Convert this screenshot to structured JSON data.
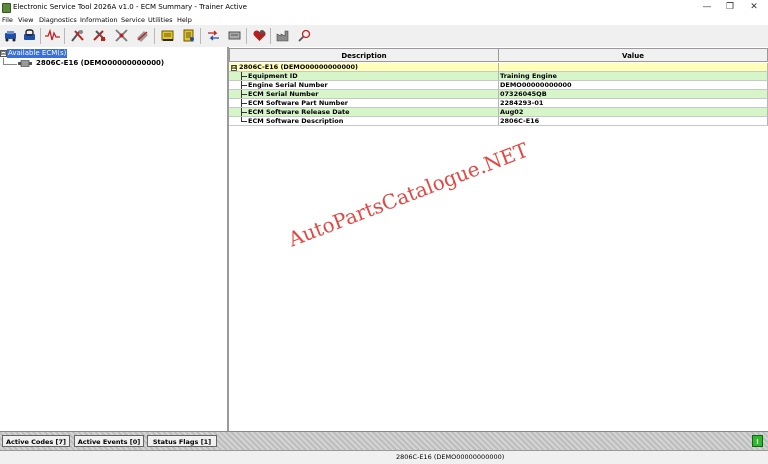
{
  "window": {
    "title": "Electronic Service Tool 2026A v1.0 - ECM Summary - Trainer Active",
    "controls": [
      "—",
      "❐",
      "✕"
    ]
  },
  "menu": [
    "File",
    "View",
    "Diagnostics",
    "Information",
    "Service",
    "Utilities",
    "Help"
  ],
  "toolbar": {
    "icons": [
      "connect-icon",
      "disconnect-icon",
      "waveform-icon",
      "diag-tools-1-icon",
      "diag-tools-2-icon",
      "diag-tools-3-icon",
      "diag-tools-4-icon",
      "info-book-icon",
      "info-list-icon",
      "transfer-icon",
      "config-icon",
      "heart-icon",
      "factory-icon",
      "search-icon"
    ]
  },
  "tree": {
    "root_label": "Available ECM(s)",
    "root_toggle": "⊟",
    "child_label": "2806C-E16 (DEMO00000000000)"
  },
  "grid": {
    "headers": [
      "Description",
      "Value"
    ],
    "group_label": "2806C-E16 (DEMO00000000000)",
    "group_toggle": "⊟",
    "rows": [
      {
        "description": "Equipment ID",
        "value": "Training Engine"
      },
      {
        "description": "Engine Serial Number",
        "value": "DEMO00000000000"
      },
      {
        "description": "ECM Serial Number",
        "value": "07326045QB"
      },
      {
        "description": "ECM Software Part Number",
        "value": "2284293-01"
      },
      {
        "description": "ECM Software Release Date",
        "value": "Aug02"
      },
      {
        "description": "ECM Software Description",
        "value": "2806C-E16"
      }
    ]
  },
  "watermark": "AutoPartsCatalogue.NET",
  "bottom_tabs": [
    {
      "label": "Active Codes [7]"
    },
    {
      "label": "Active Events [0]"
    },
    {
      "label": "Status Flags [1]"
    }
  ],
  "status_indicator": "!",
  "status_bar": {
    "text": "2806C-E16 (DEMO00000000000)"
  },
  "colors": {
    "row_yellow": "#ffffb8",
    "row_green": "#d6f5c8",
    "tree_selection": "#3a6ed8",
    "watermark": "#e0342e",
    "status_indicator": "#2fb82f"
  }
}
